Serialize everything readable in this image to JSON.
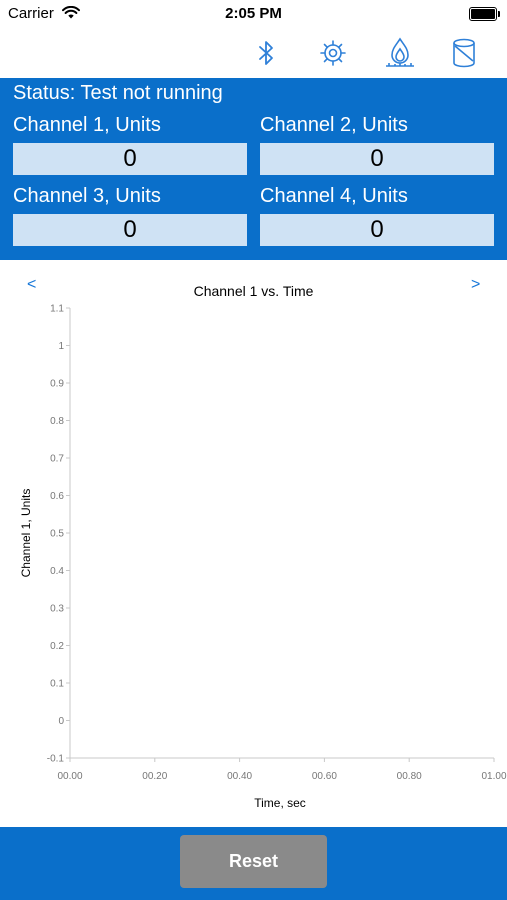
{
  "status_bar": {
    "carrier": "Carrier",
    "time": "2:05 PM"
  },
  "toolbar": {
    "icons": [
      "bluetooth-icon",
      "gear-icon",
      "flame-icon",
      "cylinder-icon"
    ],
    "accent": "#2f80d8"
  },
  "panel": {
    "status": "Status: Test not running",
    "channels": [
      {
        "label": "Channel 1, Units",
        "value": "0"
      },
      {
        "label": "Channel 2, Units",
        "value": "0"
      },
      {
        "label": "Channel 3, Units",
        "value": "0"
      },
      {
        "label": "Channel 4, Units",
        "value": "0"
      }
    ],
    "background": "#0a6fca"
  },
  "chart_nav": {
    "prev": "<",
    "next": ">"
  },
  "chart_data": {
    "type": "line",
    "title": "Channel 1 vs. Time",
    "xlabel": "Time, sec",
    "ylabel": "Channel 1, Units",
    "xlim": [
      0,
      1
    ],
    "ylim": [
      -0.1,
      1.1
    ],
    "x_ticks": [
      "00.00",
      "00.20",
      "00.40",
      "00.60",
      "00.80",
      "01.00"
    ],
    "y_ticks": [
      "1.1",
      "1",
      "0.9",
      "0.8",
      "0.7",
      "0.6",
      "0.5",
      "0.4",
      "0.3",
      "0.2",
      "0.1",
      "0",
      "-0.1"
    ],
    "series": [
      {
        "values": []
      }
    ]
  },
  "footer": {
    "reset_label": "Reset"
  }
}
